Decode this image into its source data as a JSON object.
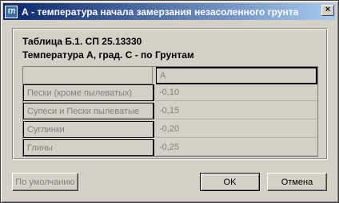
{
  "window": {
    "app_icon_text": "ГЛ",
    "title": "А - температура начала замерзания незасоленного грунта",
    "close_glyph": "×"
  },
  "caption": {
    "line1": "Таблица Б.1. СП 25.13330",
    "line2": "Температура А, град. С - по Грунтам"
  },
  "table": {
    "column_header": "А",
    "rows": [
      {
        "label": "Пески (кроме пылеватых)",
        "value": "-0,10"
      },
      {
        "label": "Супеси и Пески пылеватые",
        "value": "-0,15"
      },
      {
        "label": "Суглинки",
        "value": "-0,20"
      },
      {
        "label": "Глины",
        "value": "-0,25"
      }
    ]
  },
  "buttons": {
    "default_label": "По умолчанию",
    "ok_label": "OK",
    "cancel_label": "Отмена"
  }
}
